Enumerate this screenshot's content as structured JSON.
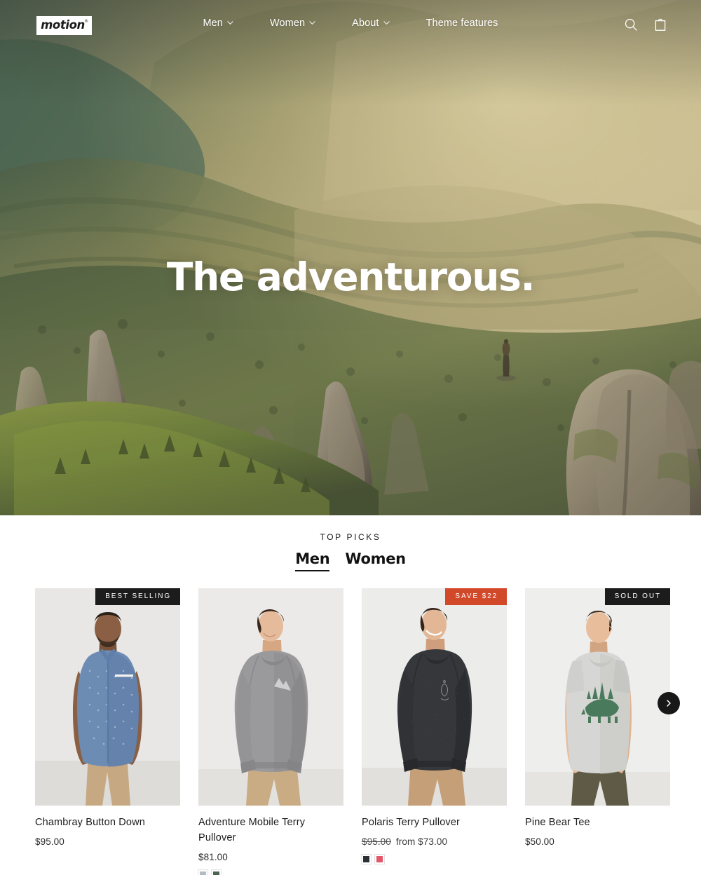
{
  "header": {
    "logo_text": "motion",
    "logo_mark": "®",
    "nav": [
      {
        "label": "Men",
        "has_dropdown": true
      },
      {
        "label": "Women",
        "has_dropdown": true
      },
      {
        "label": "About",
        "has_dropdown": true
      },
      {
        "label": "Theme features",
        "has_dropdown": false
      }
    ],
    "icons": [
      {
        "name": "search-icon",
        "label": "Search"
      },
      {
        "name": "cart-icon",
        "label": "Cart"
      }
    ]
  },
  "hero": {
    "title": "The adventurous.",
    "scene": "sunlit mountain ridges with rocky spires and a lone hiker standing on a summit",
    "sky_color": "#b9ad86",
    "haze_color": "#c8bb90",
    "forest_color": "#6d7a4a"
  },
  "picks": {
    "eyebrow": "TOP PICKS",
    "tabs": [
      {
        "label": "Men",
        "active": true
      },
      {
        "label": "Women",
        "active": false
      }
    ],
    "next_arrow": "›"
  },
  "products": [
    {
      "title": "Chambray Button Down",
      "price": "$95.00",
      "compare_at": "",
      "from_label": "",
      "badge": {
        "text": "BEST SELLING",
        "style": "dark"
      },
      "swatches": [],
      "image": {
        "bg": "#e8e7e5",
        "garment": "#6d8cb4",
        "garment_shadow": "#54719a",
        "pants": "#c6a982",
        "skin": "#8a5f43",
        "hair": "#2b2017"
      }
    },
    {
      "title": "Adventure Mobile Terry Pullover",
      "price": "$81.00",
      "compare_at": "",
      "from_label": "",
      "badge": null,
      "swatches": [
        "#b2bcc6",
        "#4a6352"
      ],
      "image": {
        "bg": "#eceae8",
        "garment": "#9a9a9c",
        "garment_shadow": "#7e7e82",
        "pants": "#c9ab84",
        "skin": "#e5bb9b",
        "hair": "#39271b"
      }
    },
    {
      "title": "Polaris Terry Pullover",
      "price": "from $73.00",
      "compare_at": "$95.00",
      "from_label": "from",
      "badge": {
        "text": "SAVE $22",
        "style": "sale"
      },
      "swatches": [
        "#2c2f34",
        "#e4566a"
      ],
      "image": {
        "bg": "#ececea",
        "garment": "#35373b",
        "garment_shadow": "#25272a",
        "pants": "#c49f77",
        "skin": "#e3b795",
        "hair": "#33231a"
      }
    },
    {
      "title": "Pine Bear Tee",
      "price": "$50.00",
      "compare_at": "",
      "from_label": "",
      "badge": {
        "text": "SOLD OUT",
        "style": "dark"
      },
      "swatches": [],
      "image": {
        "bg": "#eeeeec",
        "garment": "#d6d6d4",
        "garment_shadow": "#c2c2bf",
        "pants": "#5e5a45",
        "skin": "#e7bd9c",
        "hair": "#3a2a1d",
        "graphic": "#4a7a5c"
      }
    }
  ],
  "colors": {
    "sale_badge": "#d2492a",
    "dark_badge": "#1c1c1c",
    "text": "#1c1b1b",
    "page_bg": "#ffffff"
  }
}
